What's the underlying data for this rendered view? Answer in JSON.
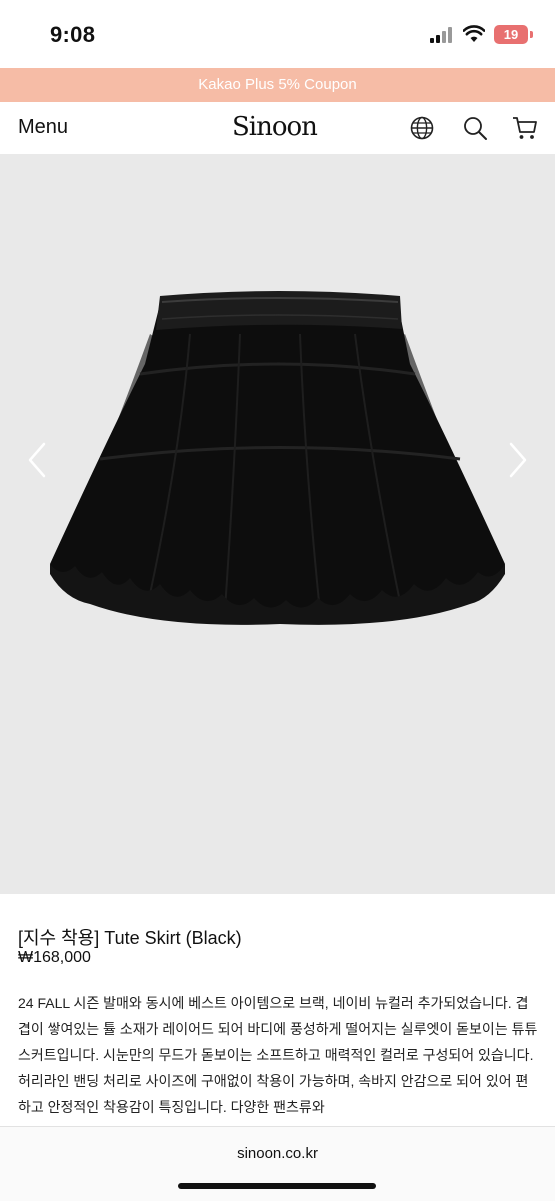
{
  "status_bar": {
    "time": "9:08",
    "battery": "19"
  },
  "promo": {
    "text": "Kakao Plus 5% Coupon"
  },
  "header": {
    "menu_label": "Menu",
    "logo": "Sinoon",
    "icons": [
      "globe-icon",
      "search-icon",
      "cart-icon"
    ]
  },
  "gallery": {
    "prev_icon": "chevron-left-icon",
    "next_icon": "chevron-right-icon"
  },
  "product": {
    "title": "[지수 착용] Tute Skirt (Black)",
    "price": "₩168,000",
    "description": "24 FALL 시즌 발매와 동시에 베스트 아이템으로 브랙, 네이비 뉴컬러 추가되었습니다. 겹겹이 쌓여있는 튤 소재가 레이어드 되어 바디에 풍성하게 떨어지는 실루엣이 돋보이는 튜튜스커트입니다. 시눈만의 무드가 돋보이는 소프트하고 매력적인 컬러로 구성되어 있습니다. 허리라인 밴딩 처리로 사이즈에 구애없이 착용이 가능하며, 속바지 안감으로 되어 있어 편하고 안정적인 착용감이 특징입니다. 다양한 팬츠류와"
  },
  "browser": {
    "domain": "sinoon.co.kr"
  },
  "colors": {
    "promo_bg": "#f6bca6",
    "battery": "#e87070",
    "gallery_bg": "#e9e9e9"
  }
}
